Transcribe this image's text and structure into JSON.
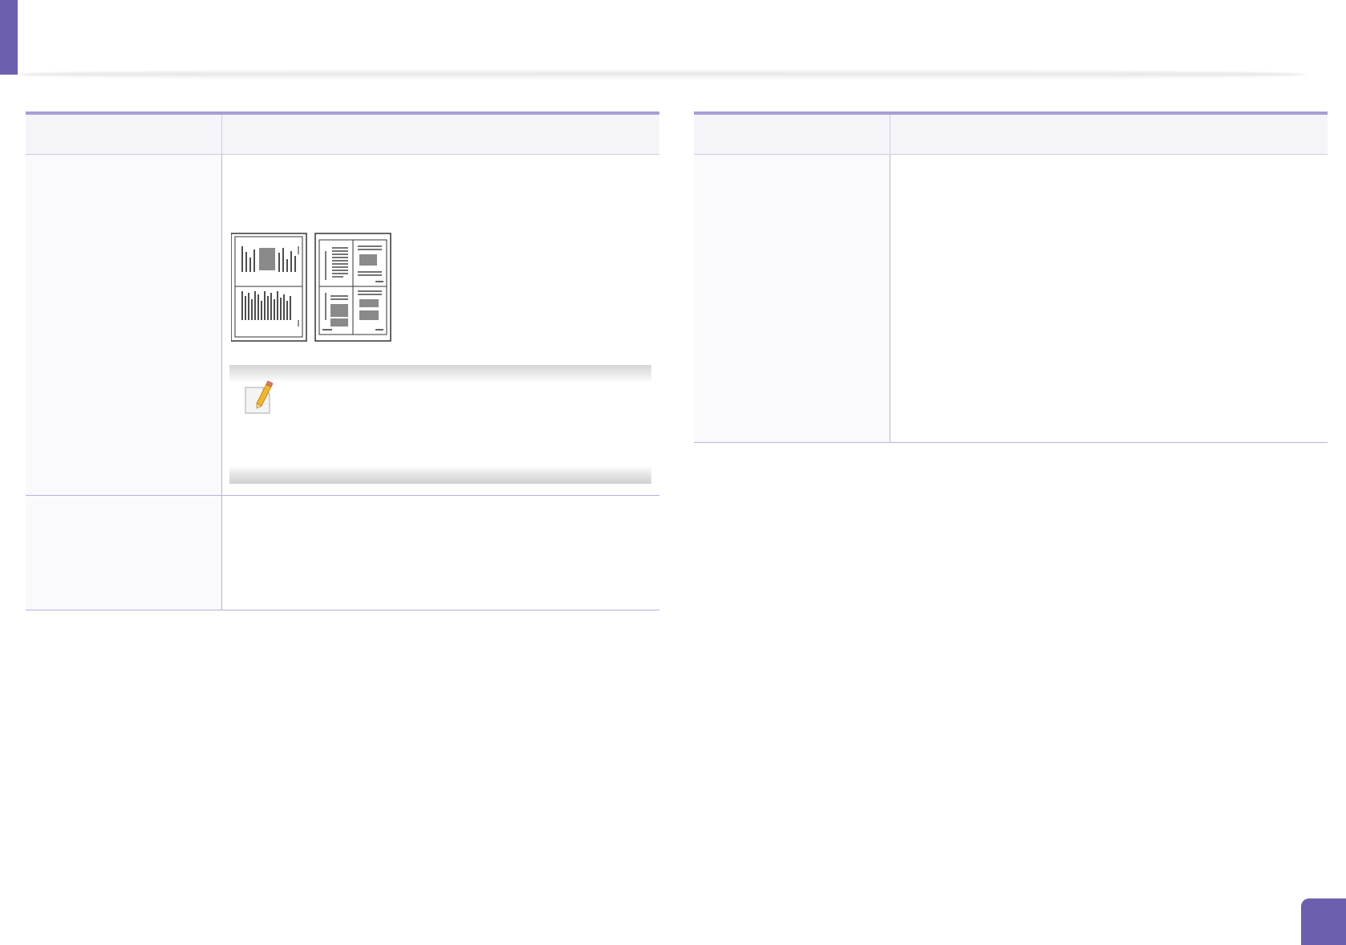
{
  "page": {
    "accent_color": "#6b5fae",
    "table_rule_color": "#a69ed6",
    "grid_line_color": "#b7b0dc"
  },
  "left_table": {
    "header": {
      "col1": "",
      "col2": ""
    },
    "rows": [
      {
        "label": "",
        "text": "",
        "illustration_icons": [
          "page-poster-icon",
          "page-2up-booklet-icon"
        ],
        "note_icon": "note-pencil-icon",
        "note_text": ""
      },
      {
        "label": "",
        "text": ""
      }
    ]
  },
  "right_table": {
    "header": {
      "col1": "",
      "col2": ""
    },
    "rows": [
      {
        "label": "",
        "text": ""
      }
    ]
  },
  "footer": {
    "page_badge_icon": "page-number-badge",
    "page_number": ""
  }
}
